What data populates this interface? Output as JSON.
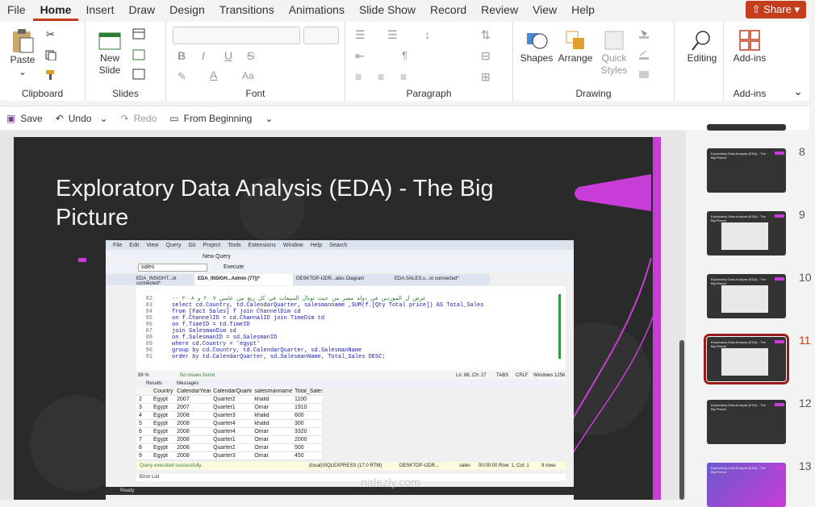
{
  "menu": {
    "tabs": [
      "File",
      "Home",
      "Insert",
      "Draw",
      "Design",
      "Transitions",
      "Animations",
      "Slide Show",
      "Record",
      "Review",
      "View",
      "Help"
    ],
    "share": "Share"
  },
  "ribbon": {
    "clipboard": {
      "paste": "Paste",
      "label": "Clipboard"
    },
    "slides": {
      "new_slide_1": "New",
      "new_slide_2": "Slide",
      "label": "Slides"
    },
    "font": {
      "label": "Font"
    },
    "paragraph": {
      "label": "Paragraph"
    },
    "drawing": {
      "shapes": "Shapes",
      "arrange": "Arrange",
      "quick1": "Quick",
      "quick2": "Styles",
      "label": "Drawing"
    },
    "editing": {
      "label": "Editing"
    },
    "addins": {
      "button": "Add-ins",
      "label": "Add-ins"
    }
  },
  "qat": {
    "save": "Save",
    "undo": "Undo",
    "redo": "Redo",
    "from_beginning": "From Beginning"
  },
  "slide": {
    "title": "Exploratory Data Analysis (EDA) - The Big Picture"
  },
  "screenshot": {
    "menu": [
      "File",
      "Edit",
      "View",
      "Query",
      "Git",
      "Project",
      "Tools",
      "Extensions",
      "Window",
      "Help"
    ],
    "search": "Search",
    "db": "sales",
    "execute": "Execute",
    "new_query": "New Query",
    "tabs": [
      "EDA_INSIGHT...ot connected*",
      "EDA_INSIGH...Admin (77))*",
      "DESKTOP-IJDR...ales Diagram",
      "EDA.SALES.s...ot connected*"
    ],
    "code": [
      {
        "n": "82",
        "t": "-- عرض ل الموردين في دولة مصر من حيث توتال المبيعات في كل ربع من عامين ٢٠٠٧ و ٢٠٠٨"
      },
      {
        "n": "83",
        "t": "select cd.Country, td.CalendarQuarter, salesmanname ,SUM(f.[Qty Total price]) AS Total_Sales"
      },
      {
        "n": "84",
        "t": "from [Fact Sales] f join ChannelDim cd"
      },
      {
        "n": "85",
        "t": "on f.ChannelID = cd.ChannalID join TimeDim td"
      },
      {
        "n": "86",
        "t": "on f.TimeID = td.TimeID"
      },
      {
        "n": "87",
        "t": "join SalesmanDim sd"
      },
      {
        "n": "88",
        "t": "on f.SalesmanID = sd.SalesmanID"
      },
      {
        "n": "89",
        "t": "where cd.Country = 'egypt'"
      },
      {
        "n": "90",
        "t": "group by cd.Country, td.CalendarQuarter, sd.SalesmanName"
      },
      {
        "n": "91",
        "t": "order by td.CalendarQuarter, sd.SalesmanName, Total_Sales DESC;"
      }
    ],
    "zoom": "99 %",
    "no_issues": "No issues found",
    "position": "Ln: 88, Ch: 27",
    "tabs_mode": "TABS",
    "crlf": "CRLF",
    "encoding": "Windows 1256",
    "results_tab": "Results",
    "messages_tab": "Messages",
    "grid_headers": [
      "Country",
      "CalendarYear",
      "CalendarQuarter",
      "salesmanname",
      "Total_Sales"
    ],
    "grid_rows": [
      [
        "2",
        "Egypt",
        "2007",
        "Quarter2",
        "khalid",
        "1100"
      ],
      [
        "3",
        "Egypt",
        "2007",
        "Quarter1",
        "Omar",
        "1910"
      ],
      [
        "4",
        "Egypt",
        "2008",
        "Quarter3",
        "khalid",
        "600"
      ],
      [
        "5",
        "Egypt",
        "2008",
        "Quarter4",
        "khalid",
        "300"
      ],
      [
        "6",
        "Egypt",
        "2008",
        "Quarter4",
        "Omar",
        "3320"
      ],
      [
        "7",
        "Egypt",
        "2008",
        "Quarter1",
        "Omar",
        "2000"
      ],
      [
        "8",
        "Egypt",
        "2008",
        "Quarter2",
        "Omar",
        "500"
      ],
      [
        "9",
        "Egypt",
        "2008",
        "Quarter3",
        "Omar",
        "450"
      ]
    ],
    "status": "Query executed successfully.",
    "server": "(local)\\SQLEXPRESS (17.0 RTM)",
    "desktop": "DESKTOP-IJDR...",
    "db2": "sales",
    "rowcol": "00:00:00  Row: 1, Col: 1",
    "rows": "9 rows",
    "error_list": "Error List",
    "ready": "Ready",
    "watermark": "nafezly.com"
  },
  "thumbnails": [
    {
      "n": "8"
    },
    {
      "n": "9"
    },
    {
      "n": "10"
    },
    {
      "n": "11"
    },
    {
      "n": "12"
    },
    {
      "n": "13"
    }
  ],
  "thumb_title": "Exploratory Data Analysis (EDA) - The Big Picture",
  "colors": {
    "accent": "#c43e1c",
    "magenta": "#c83cd8",
    "selected": "#9b1b1b"
  }
}
